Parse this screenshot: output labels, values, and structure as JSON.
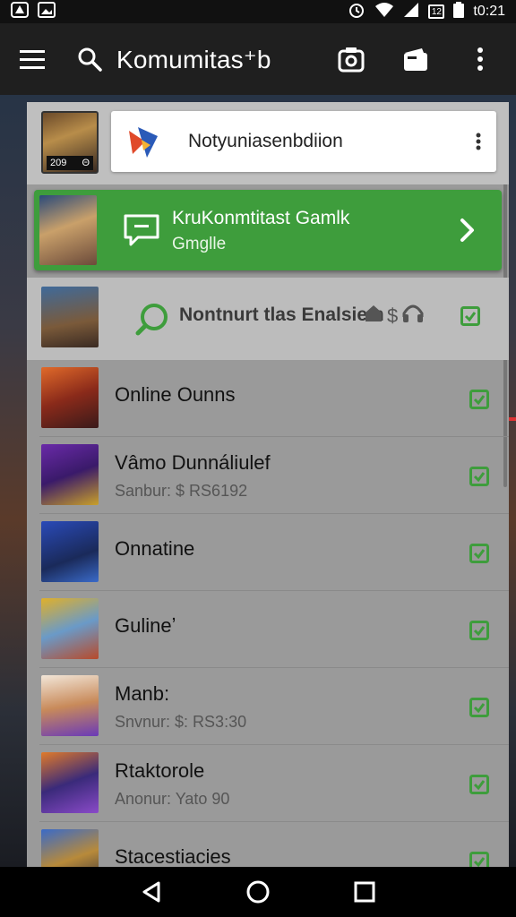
{
  "status_bar": {
    "time": "t0:21",
    "left_icons": [
      "app-icon",
      "image-icon"
    ],
    "right_icons": [
      "alarm-icon",
      "wifi-icon",
      "signal-icon",
      "sim-icon",
      "battery-icon"
    ],
    "sim_text": "12"
  },
  "app_bar": {
    "title": "Komumitas⁺b",
    "icons": [
      "menu-icon",
      "search-icon",
      "camera-icon",
      "wallet-icon",
      "more-vert-icon"
    ]
  },
  "search_header": {
    "thumb_tag_left": "209",
    "thumb_tag_right": "Θ",
    "text": "Notyuniasenbdiion"
  },
  "highlight": {
    "title": "KruKonmtitast Gamlk",
    "subtitle": "Gmglle",
    "accent": "#3e9d3c"
  },
  "featured": {
    "text": "Nontnurt tlas Enalsiem",
    "extra": "$"
  },
  "list": [
    {
      "name": "Online Ounns",
      "sub": ""
    },
    {
      "name": "Vâmo Dunnáliulef",
      "sub": "Sanbur: $ RS6192"
    },
    {
      "name": "Onnatine",
      "sub": ""
    },
    {
      "name": "Gulineʼ",
      "sub": ""
    },
    {
      "name": "Manb:",
      "sub": "Snvnur: $: RS3:30"
    },
    {
      "name": "Rtaktorole",
      "sub": "Anonur: Yato 90"
    },
    {
      "name": "Stacestiacies",
      "sub": ""
    }
  ],
  "nav": [
    "back-icon",
    "home-icon",
    "recents-icon"
  ]
}
